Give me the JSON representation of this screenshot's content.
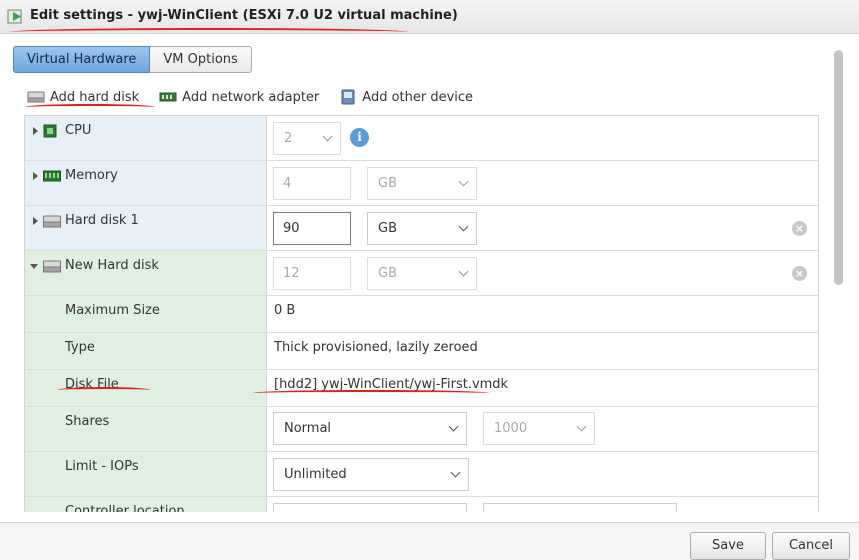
{
  "window": {
    "title": "Edit settings - ywj-WinClient (ESXi 7.0 U2 virtual machine)",
    "icon": "vm-power-icon"
  },
  "tabs": [
    {
      "label": "Virtual Hardware",
      "active": true
    },
    {
      "label": "VM Options",
      "active": false
    }
  ],
  "toolbar": {
    "add_hard_disk": "Add hard disk",
    "add_network_adapter": "Add network adapter",
    "add_other_device": "Add other device"
  },
  "hardware": {
    "cpu": {
      "label": "CPU",
      "value": "2"
    },
    "memory": {
      "label": "Memory",
      "value": "4",
      "unit": "GB"
    },
    "hard_disk_1": {
      "label": "Hard disk 1",
      "value": "90",
      "unit": "GB"
    },
    "new_hard_disk": {
      "label": "New Hard disk",
      "value": "12",
      "unit": "GB",
      "maximum_size": {
        "label": "Maximum Size",
        "value": "0 B"
      },
      "type": {
        "label": "Type",
        "value": "Thick provisioned, lazily zeroed"
      },
      "disk_file": {
        "label": "Disk File",
        "value": "[hdd2] ywj-WinClient/ywj-First.vmdk"
      },
      "shares": {
        "label": "Shares",
        "value": "Normal",
        "amount": "1000"
      },
      "limit_iops": {
        "label": "Limit - IOPs",
        "value": "Unlimited"
      },
      "controller_location": {
        "label": "Controller location"
      }
    }
  },
  "footer": {
    "save_label": "Save",
    "cancel_label": "Cancel"
  },
  "colors": {
    "annotation_red": "#e02020",
    "accent_blue": "#6fa6dc",
    "label_blue_bg": "#e6eef6",
    "label_green_bg": "#dff0e1"
  }
}
